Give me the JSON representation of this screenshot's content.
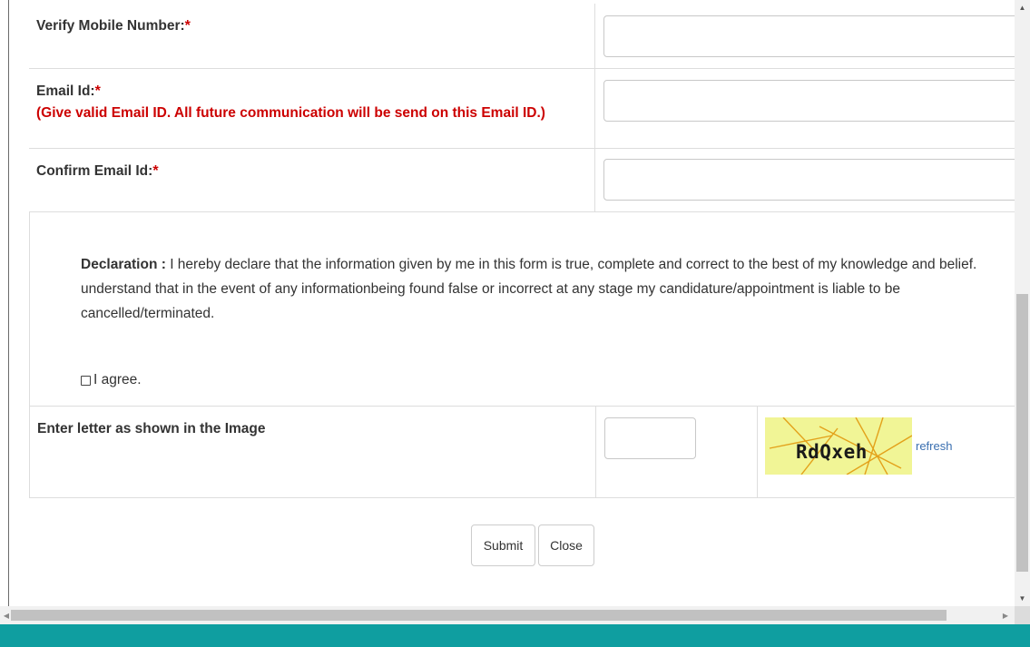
{
  "form": {
    "verify_mobile": {
      "label": "Verify Mobile Number:",
      "required_mark": "*",
      "value": ""
    },
    "email": {
      "label": "Email Id:",
      "required_mark": "*",
      "note": "(Give valid Email ID. All future communication will be send on this Email ID.)",
      "value": ""
    },
    "confirm_email": {
      "label": "Confirm Email Id:",
      "required_mark": "*",
      "value": ""
    },
    "declaration": {
      "title": "Declaration :",
      "text": " I hereby declare that the information given by me in this form is true, complete and correct to the best of my knowledge and belief. understand that in the event of any informationbeing found false or incorrect at any stage my candidature/appointment is liable to be cancelled/terminated.",
      "agree_label": "I agree.",
      "agree_checked": false
    },
    "captcha": {
      "label": "Enter letter as shown in the Image",
      "value": "",
      "image_text": "RdQxeh",
      "refresh_label": "refresh"
    }
  },
  "actions": {
    "submit_label": "Submit",
    "close_label": "Close"
  },
  "colors": {
    "required": "#cc0000",
    "footer": "#0f9ea0",
    "captcha_bg": "#f1f596",
    "link": "#3a6fb0"
  }
}
